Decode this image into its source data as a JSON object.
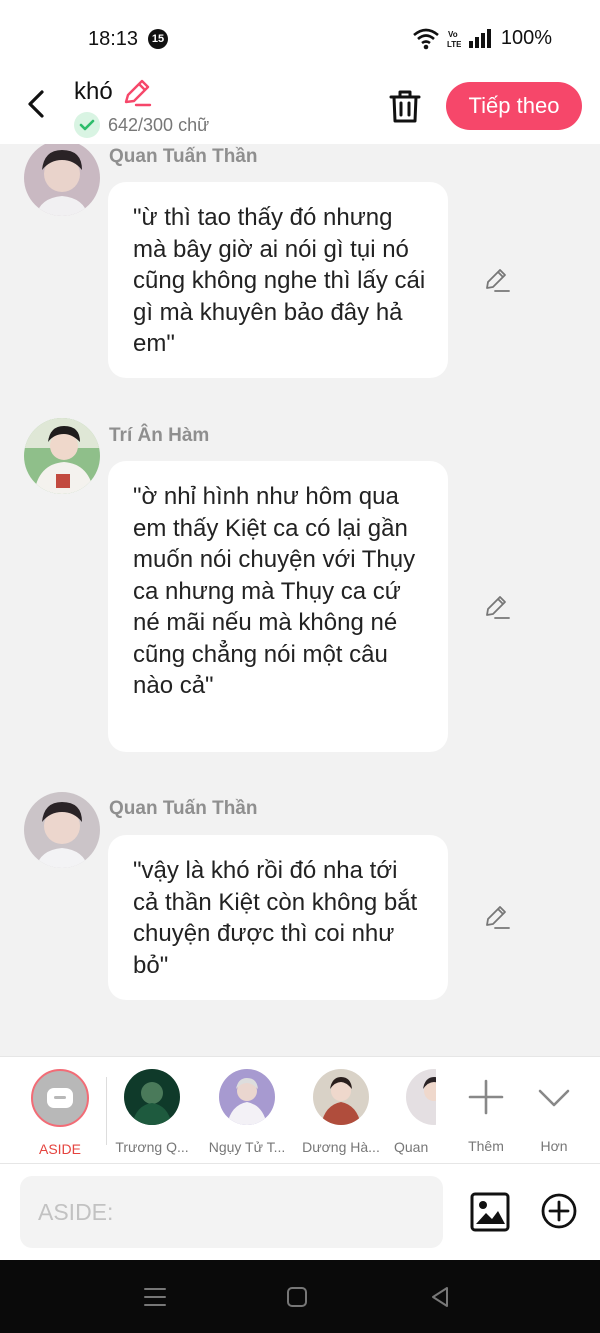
{
  "status_bar": {
    "time": "18:13",
    "notif_count": "15",
    "battery": "100%",
    "network": "Vo LTE"
  },
  "header": {
    "title": "khó",
    "word_count": "642/300 chữ",
    "next_label": "Tiếp theo"
  },
  "messages": [
    {
      "speaker": "Quan Tuấn Thần",
      "text": "\"ừ thì tao thấy đó nhưng mà bây giờ ai nói gì tụi nó cũng không nghe thì lấy cái gì mà khuyên bảo đây hả em\""
    },
    {
      "speaker": "Trí Ân Hàm",
      "text": "\"ờ nhỉ hình như hôm qua em thấy Kiệt ca có lại gần muốn nói chuyện với Thụy ca nhưng mà Thụy ca cứ né mãi nếu mà không né cũng chẳng nói một câu nào cả\""
    },
    {
      "speaker": "Quan Tuấn Thần",
      "text": "\"vậy là khó rồi đó nha tới cả thần Kiệt còn không bắt chuyện được thì coi như bỏ\""
    }
  ],
  "characters": [
    {
      "label": "ASIDE",
      "selected": true
    },
    {
      "label": "Trương Q..."
    },
    {
      "label": "Ngụy Tử T..."
    },
    {
      "label": "Dương Hà..."
    },
    {
      "label": "Quan"
    }
  ],
  "more": {
    "add_label": "Thêm",
    "more_label": "Hơn"
  },
  "input": {
    "placeholder": "ASIDE:"
  },
  "colors": {
    "accent": "#f6476a",
    "bubble": "#ffffff",
    "background": "#f2f2f2"
  }
}
